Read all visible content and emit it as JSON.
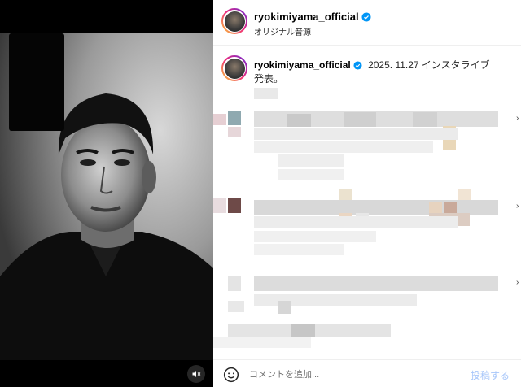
{
  "header": {
    "username": "ryokimiyama_official",
    "audio_label": "オリジナル音源"
  },
  "caption": {
    "username": "ryokimiyama_official",
    "text_line1": "2025. 11.27 インスタライブ",
    "text_line2": "発表。"
  },
  "comment_box": {
    "placeholder": "コメントを追加...",
    "post_label": "投稿する"
  },
  "media": {
    "muted": true
  },
  "colors": {
    "verified_blue": "#0095f6",
    "post_button": "#a8c7fa"
  },
  "icons": [
    "verified-icon",
    "speaker-muted-icon",
    "emoji-icon",
    "chevron-right-icon"
  ]
}
